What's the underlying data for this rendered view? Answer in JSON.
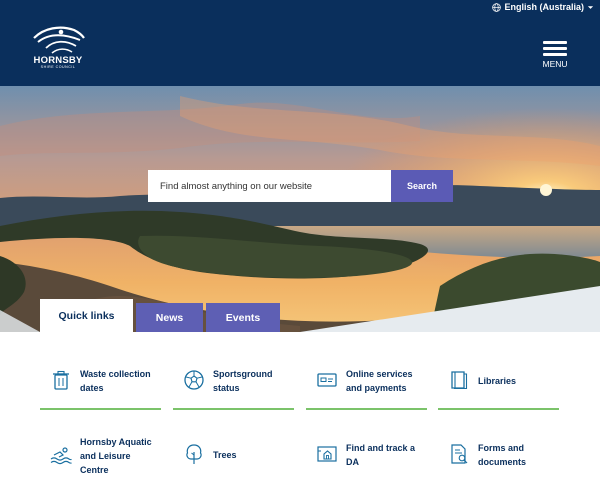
{
  "header": {
    "language": "English (Australia)",
    "logo_name": "HORNSBY",
    "logo_sub": "SHIRE COUNCIL",
    "menu_label": "MENU"
  },
  "search": {
    "placeholder": "Find almost anything on our website",
    "button_label": "Search"
  },
  "tabs": [
    {
      "label": "Quick links",
      "active": true
    },
    {
      "label": "News",
      "active": false
    },
    {
      "label": "Events",
      "active": false
    }
  ],
  "quick_links": [
    {
      "label": "Waste collection dates",
      "icon": "bin-icon"
    },
    {
      "label": "Sportsground status",
      "icon": "soccer-ball-icon"
    },
    {
      "label": "Online services and payments",
      "icon": "payment-card-icon"
    },
    {
      "label": "Libraries",
      "icon": "book-icon"
    },
    {
      "label": "Hornsby Aquatic and Leisure Centre",
      "icon": "swimmer-icon"
    },
    {
      "label": "Trees",
      "icon": "tree-icon"
    },
    {
      "label": "Find and track a DA",
      "icon": "house-plan-icon"
    },
    {
      "label": "Forms and documents",
      "icon": "document-search-icon"
    }
  ],
  "colors": {
    "header_bg": "#0a2f5c",
    "accent_purple": "#5b5bb5",
    "link_text": "#0a2f5c",
    "underline_green": "#7bc36a",
    "icon_teal": "#1a6fa0"
  }
}
